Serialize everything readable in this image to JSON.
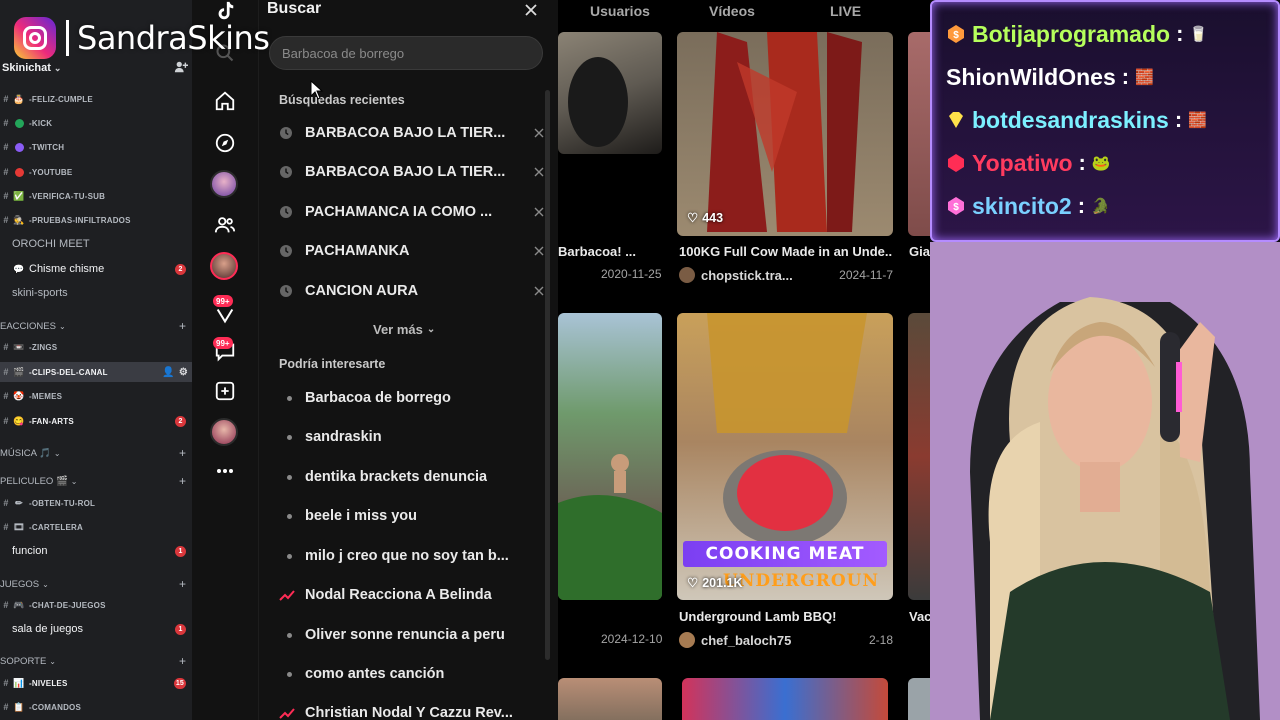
{
  "overlay": {
    "streamer_name": "SandraSkins"
  },
  "discord": {
    "server_name": "Skinichat",
    "channels": [
      {
        "prefix": "#",
        "emoji": "🎂",
        "label": "-FELIZ-CUMPLE",
        "style": "small"
      },
      {
        "prefix": "#",
        "emoji": "dot-green",
        "label": "-KICK",
        "style": "small"
      },
      {
        "prefix": "#",
        "emoji": "dot-purple",
        "label": "-TWITCH",
        "style": "small"
      },
      {
        "prefix": "#",
        "emoji": "dot-red",
        "label": "-YOUTUBE",
        "style": "small"
      },
      {
        "prefix": "#",
        "emoji": "✅",
        "label": "-VERIFICA-TU-SUB",
        "style": "small"
      },
      {
        "prefix": "#",
        "emoji": "🕵",
        "label": "-PRUEBAS-INFILTRADOS",
        "style": "small"
      },
      {
        "prefix": "",
        "emoji": "",
        "label": "OROCHI MEET",
        "style": "big"
      },
      {
        "prefix": "",
        "emoji": "💬",
        "label": "Chisme chisme",
        "style": "big",
        "badge": "2"
      },
      {
        "prefix": "",
        "emoji": "",
        "label": "skini-sports",
        "style": "big"
      }
    ],
    "category_reacciones": "EACCIONES",
    "channels2": [
      {
        "prefix": "#",
        "emoji": "📼",
        "label": "-ZINGS",
        "style": "small"
      },
      {
        "prefix": "#",
        "emoji": "🎬",
        "label": "-CLIPS-DEL-CANAL",
        "style": "small",
        "active": true
      },
      {
        "prefix": "#",
        "emoji": "🤡",
        "label": "-MEMES",
        "style": "small"
      },
      {
        "prefix": "#",
        "emoji": "😋",
        "label": "-FAN-ARTS",
        "style": "small",
        "badge": "2"
      }
    ],
    "category_musica": "MÚSICA 🎵",
    "category_peliculeo": "PELICULEO 🎬",
    "channels3": [
      {
        "prefix": "#",
        "emoji": "✏",
        "label": "-OBTEN-TU-ROL",
        "style": "small"
      },
      {
        "prefix": "#",
        "emoji": "🎞",
        "label": "-CARTELERA",
        "style": "small"
      },
      {
        "prefix": "",
        "emoji": "",
        "label": "funcion",
        "style": "big",
        "badge": "1"
      }
    ],
    "category_juegos": "JUEGOS",
    "channels4": [
      {
        "prefix": "#",
        "emoji": "🎮",
        "label": "-CHAT-DE-JUEGOS",
        "style": "small"
      },
      {
        "prefix": "",
        "emoji": "",
        "label": "sala de juegos",
        "style": "big",
        "badge": "1"
      }
    ],
    "category_soporte": "SOPORTE",
    "channels5": [
      {
        "prefix": "#",
        "emoji": "📊",
        "label": "-NIVELES",
        "style": "small",
        "badge": "15"
      },
      {
        "prefix": "#",
        "emoji": "📋",
        "label": "-COMANDOS",
        "style": "small"
      }
    ]
  },
  "tiktok": {
    "rail_badges": [
      "99+",
      "99+"
    ],
    "search": {
      "title": "Buscar",
      "placeholder": "Barbacoa de borrego",
      "recent_header": "Búsquedas recientes",
      "recent": [
        "BARBACOA BAJO LA TIER...",
        "BARBACOA BAJO LA TIER...",
        "PACHAMANCA IA COMO ...",
        "PACHAMANKA",
        "CANCION AURA"
      ],
      "see_more": "Ver más",
      "suggest_header": "Podría interesarte",
      "suggestions": [
        {
          "text": "Barbacoa de borrego",
          "trending": false
        },
        {
          "text": "sandraskin",
          "trending": false
        },
        {
          "text": "dentika brackets denuncia",
          "trending": false
        },
        {
          "text": "beele i miss you",
          "trending": false
        },
        {
          "text": "milo j creo que no soy tan b...",
          "trending": false
        },
        {
          "text": "Nodal Reacciona A Belinda",
          "trending": true
        },
        {
          "text": "Oliver sonne renuncia a peru",
          "trending": false
        },
        {
          "text": "como antes canción",
          "trending": false
        },
        {
          "text": "Christian Nodal Y Cazzu Rev...",
          "trending": true
        }
      ]
    },
    "tabs": [
      "Usuarios",
      "Vídeos",
      "LIVE"
    ],
    "videos": [
      {
        "title": "Barbacoa! ...",
        "date": "2020-11-25",
        "user": "",
        "likes": ""
      },
      {
        "title": "100KG Full Cow Made in an Unde...",
        "date": "2024-11-7",
        "user": "chopstick.tra...",
        "likes": "443"
      },
      {
        "title": "Gia",
        "date": "",
        "user": "",
        "likes": ""
      },
      {
        "title": "",
        "date": "2024-12-10",
        "user": "",
        "likes": ""
      },
      {
        "title": "Underground Lamb BBQ!",
        "date": "2-18",
        "user": "chef_baloch75",
        "likes": "201.1K",
        "banner": "COOKING MEAT",
        "banner2": "UNDERGROUN"
      },
      {
        "title": "Vac",
        "date": "",
        "user": "",
        "likes": ""
      }
    ]
  },
  "chat": {
    "messages": [
      {
        "user": "Botijaprogramado",
        "color": "#b6ff5c",
        "badge": "orange",
        "emote": "🥛"
      },
      {
        "user": "ShionWildOnes",
        "color": "#ffffff",
        "badge": "",
        "emote": "🧱"
      },
      {
        "user": "botdesandraskins",
        "color": "#7cf0ff",
        "badge": "yellow",
        "emote": "🧱"
      },
      {
        "user": "Yopatiwo",
        "color": "#ff3b5f",
        "badge": "red",
        "emote": "🐸"
      },
      {
        "user": "skincito2",
        "color": "#7ad0ff",
        "badge": "pink",
        "emote": "🐊"
      }
    ]
  },
  "colors": {
    "tiktok_red": "#fe2c55",
    "discord_bg": "#1e1f22",
    "chat_border": "#b58cff"
  }
}
